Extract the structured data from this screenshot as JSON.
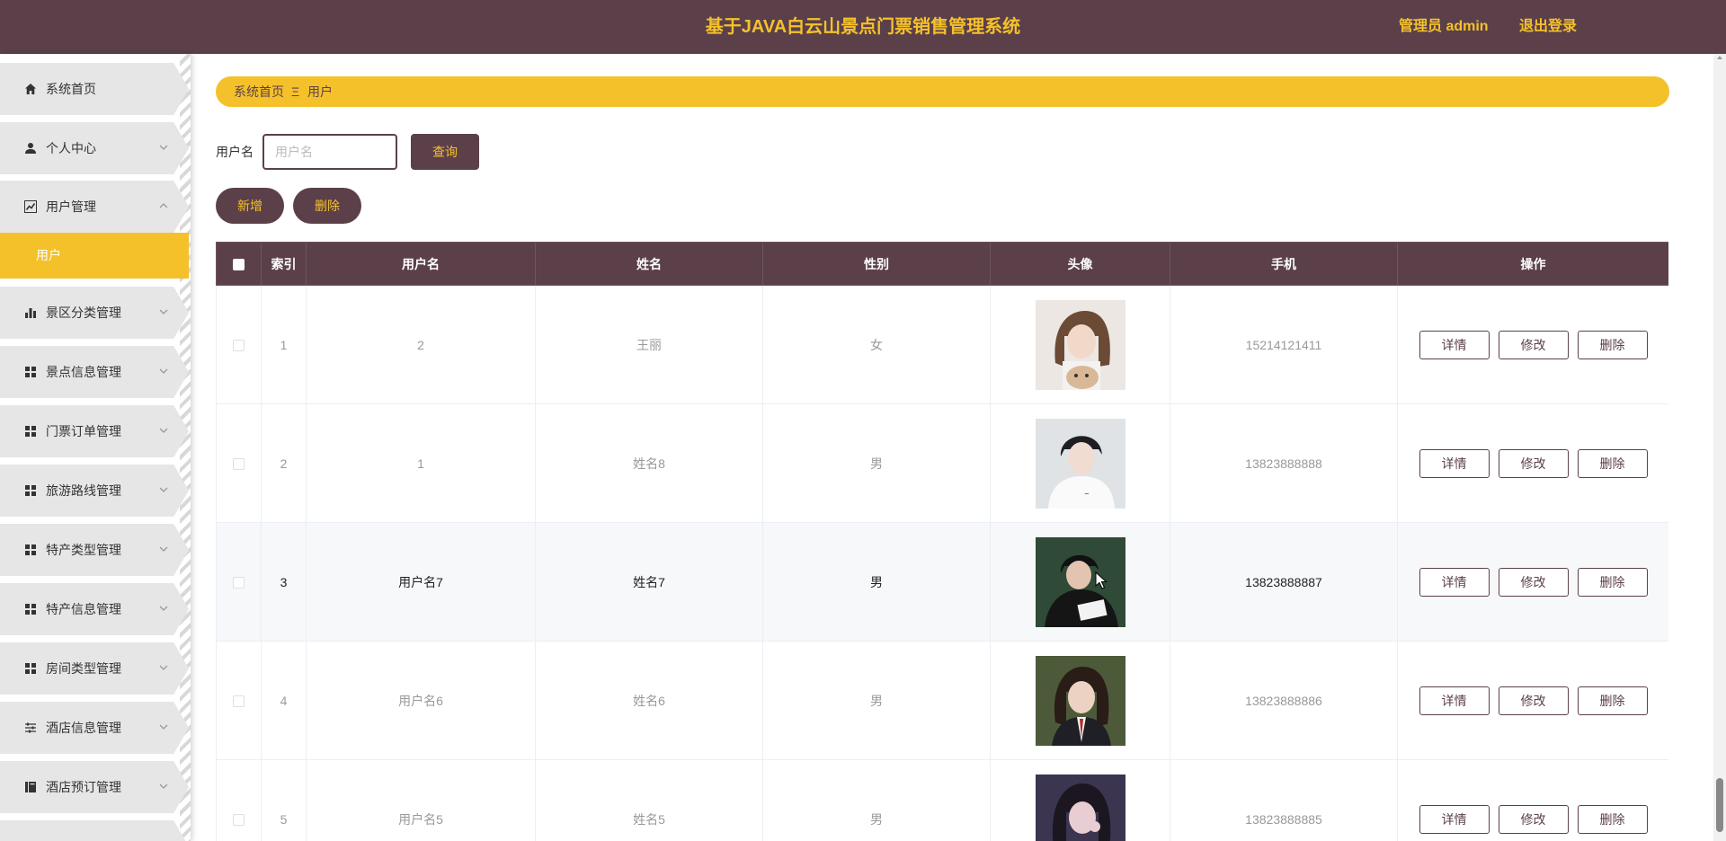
{
  "header": {
    "title": "基于JAVA白云山景点门票销售管理系统",
    "user": "管理员 admin",
    "logout": "退出登录"
  },
  "sidebar": {
    "items": [
      {
        "label": "系统首页",
        "icon": "home-icon",
        "expandable": false
      },
      {
        "label": "个人中心",
        "icon": "user-icon",
        "expandable": true
      },
      {
        "label": "用户管理",
        "icon": "chart-line-icon",
        "expandable": true,
        "expanded": true
      },
      {
        "label": "景区分类管理",
        "icon": "bar-chart-icon",
        "expandable": true
      },
      {
        "label": "景点信息管理",
        "icon": "grid-icon",
        "expandable": true
      },
      {
        "label": "门票订单管理",
        "icon": "grid-icon",
        "expandable": true
      },
      {
        "label": "旅游路线管理",
        "icon": "grid-icon",
        "expandable": true
      },
      {
        "label": "特产类型管理",
        "icon": "grid-icon",
        "expandable": true
      },
      {
        "label": "特产信息管理",
        "icon": "grid-icon",
        "expandable": true
      },
      {
        "label": "房间类型管理",
        "icon": "grid-icon",
        "expandable": true
      },
      {
        "label": "酒店信息管理",
        "icon": "sliders-icon",
        "expandable": true
      },
      {
        "label": "酒店预订管理",
        "icon": "book-icon",
        "expandable": true
      }
    ],
    "submenu": {
      "label": "用户"
    }
  },
  "breadcrumb": {
    "home": "系统首页",
    "separator": "Ξ",
    "current": "用户"
  },
  "search": {
    "label": "用户名",
    "placeholder": "用户名",
    "value": "",
    "button": "查询"
  },
  "actions": {
    "add": "新增",
    "delete": "删除"
  },
  "table": {
    "headers": [
      "索引",
      "用户名",
      "姓名",
      "性别",
      "头像",
      "手机",
      "操作"
    ],
    "rows": [
      {
        "index": "1",
        "username": "2",
        "name": "王丽",
        "gender": "女",
        "phone": "15214121411"
      },
      {
        "index": "2",
        "username": "1",
        "name": "姓名8",
        "gender": "男",
        "phone": "13823888888"
      },
      {
        "index": "3",
        "username": "用户名7",
        "name": "姓名7",
        "gender": "男",
        "phone": "13823888887"
      },
      {
        "index": "4",
        "username": "用户名6",
        "name": "姓名6",
        "gender": "男",
        "phone": "13823888886"
      },
      {
        "index": "5",
        "username": "用户名5",
        "name": "姓名5",
        "gender": "男",
        "phone": "13823888885"
      }
    ],
    "row_actions": {
      "detail": "详情",
      "edit": "修改",
      "delete": "删除"
    }
  },
  "colors": {
    "primary": "#5b4049",
    "accent": "#f5c12b",
    "menu_bg": "#e6e6e6"
  }
}
